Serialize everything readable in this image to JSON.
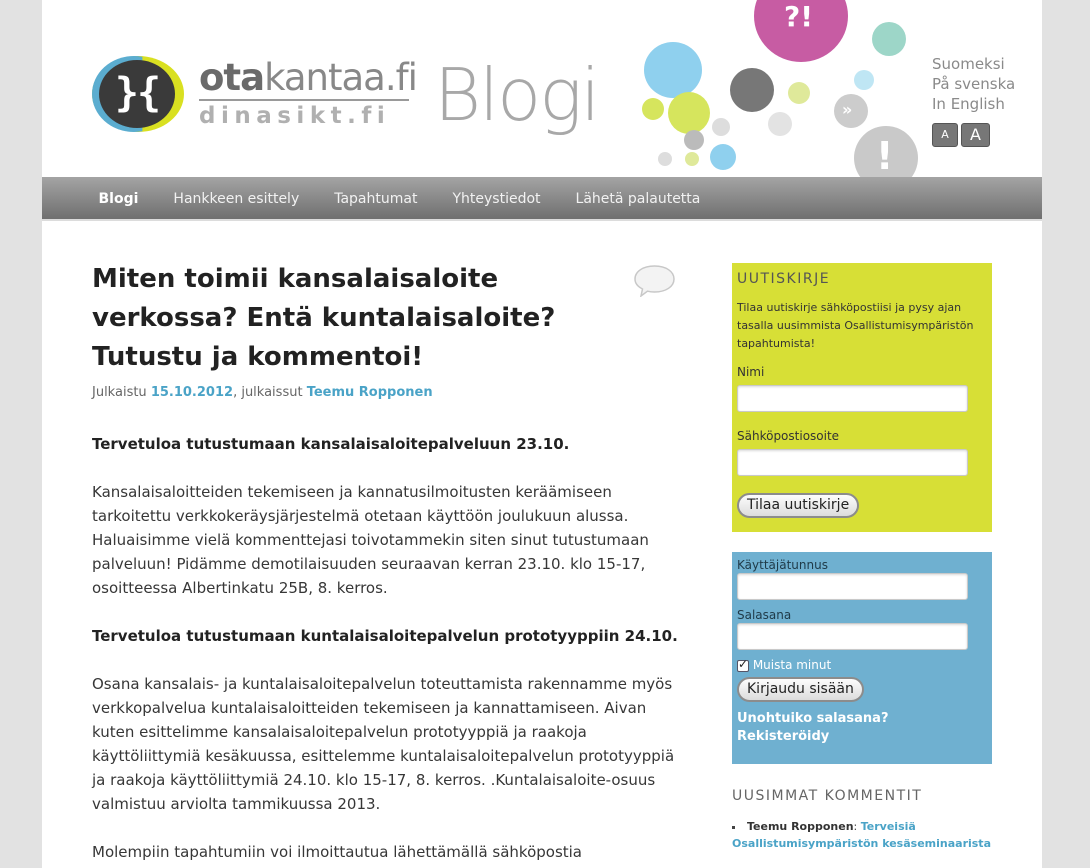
{
  "header": {
    "logo_glyph": "}{",
    "wordmark_top_bold": "ota",
    "wordmark_top_light": "kantaa.fi",
    "wordmark_bottom": "dinasikt.fi",
    "blog_title": "Blogi",
    "languages": [
      "Suomeksi",
      "På svenska",
      "In English"
    ],
    "font_small_label": "A",
    "font_large_label": "A"
  },
  "nav": {
    "items": [
      "Blogi",
      "Hankkeen esittely",
      "Tapahtumat",
      "Yhteystiedot",
      "Lähetä palautetta"
    ]
  },
  "article": {
    "title": "Miten toimii kansalaisaloite verkossa? Entä kuntalaisaloite? Tutustu ja kommentoi!",
    "meta_prefix": "Julkaistu ",
    "date": "15.10.2012",
    "meta_middle": ", julkaissut ",
    "author": "Teemu Ropponen",
    "paragraphs": [
      "Tervetuloa tutustumaan kansalaisaloitepalveluun 23.10.",
      "Kansalaisaloitteiden tekemiseen ja kannatusilmoitusten keräämiseen tarkoitettu verkkokeräysjärjestelmä otetaan käyttöön joulukuun alussa. Haluaisimme vielä kommenttejasi toivotammekin siten sinut tutustumaan palveluun! Pidämme demotilaisuuden seuraavan kerran 23.10. klo 15-17, osoitteessa Albertinkatu 25B, 8. kerros.",
      "Tervetuloa tutustumaan kuntalaisaloitepalvelun prototyyppiin 24.10.",
      "Osana kansalais- ja kuntalaisaloitepalvelun toteuttamista rakennamme myös verkkopalvelua kuntalaisaloitteiden tekemiseen ja kannattamiseen. Aivan kuten esittelimme kansalaisaloitepalvelun prototyyppiä ja raakoja käyttöliittymiä kesäkuussa, esittelemme kuntalaisaloitepalvelun prototyyppiä ja raakoja käyttöliittymiä 24.10.  klo 15-17, 8. kerros. .Kuntalaisaloite-osuus valmistuu arviolta tammikuussa 2013.",
      "Molempiin tapahtumiin voi ilmoittautua lähettämällä sähköpostia osoitteeseen"
    ]
  },
  "newsletter": {
    "heading": "UUTISKIRJE",
    "description": "Tilaa uutiskirje sähköpostiisi ja pysy ajan tasalla uusimmista Osallistumisympäristön tapahtumista!",
    "name_label": "Nimi",
    "email_label": "Sähköpostiosoite",
    "subscribe_button": "Tilaa uutiskirje"
  },
  "login": {
    "username_label": "Käyttäjätunnus",
    "password_label": "Salasana",
    "remember_label": "Muista minut",
    "login_button": "Kirjaudu sisään",
    "forgot_link": "Unohtuiko salasana?",
    "register_link": "Rekisteröidy"
  },
  "recent_comments": {
    "heading": "UUSIMMAT KOMMENTIT",
    "items": [
      {
        "author": "Teemu Ropponen",
        "separator": ": ",
        "post": "Terveisiä Osallistumisympäristön kesäseminaarista"
      }
    ]
  },
  "colors": {
    "accent_blue": "#4aa3c7",
    "newsletter_bg": "#d7df36",
    "login_bg": "#6fb0d0",
    "bubble_pink": "#c75ca3",
    "bubble_lightblue": "#8fd0ee",
    "bubble_green": "#d6e55d",
    "bubble_gray": "#c9c9c9"
  },
  "icons": [
    "speech-bubble-question-icon",
    "speech-bubble-exclamation-icon",
    "comment-bubble-icon",
    "person-icon"
  ]
}
